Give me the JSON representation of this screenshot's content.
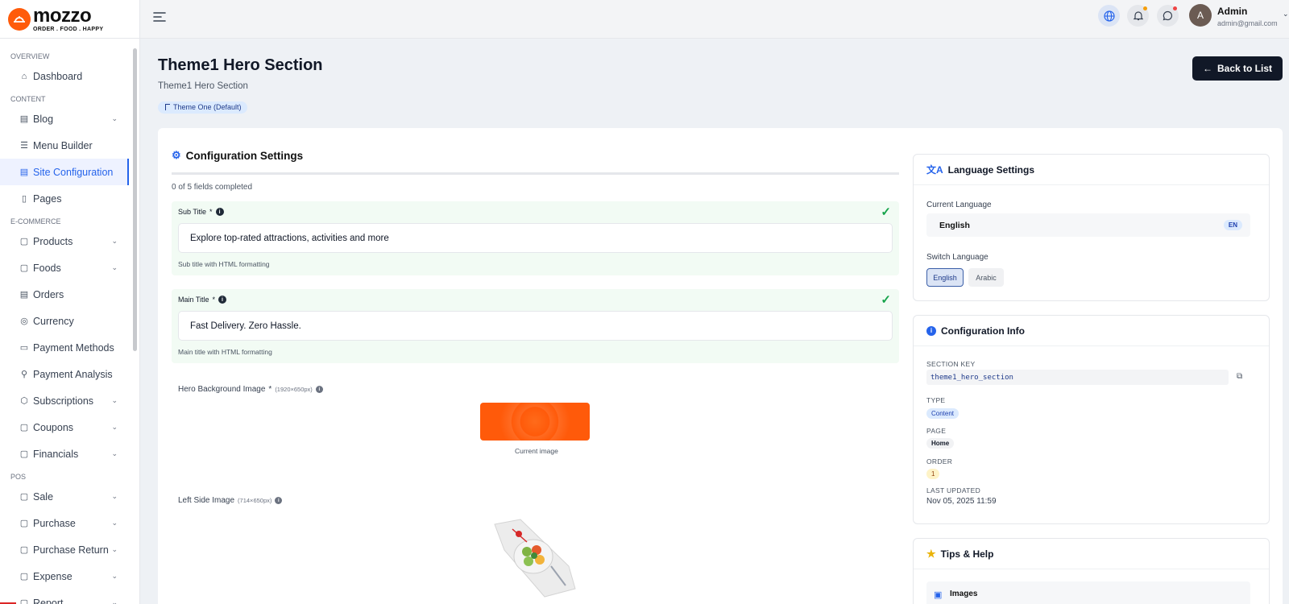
{
  "brand": {
    "name": "mozzo",
    "tagline": "ORDER . FOOD . HAPPY"
  },
  "sidebar": {
    "sections": [
      {
        "title": "OVERVIEW",
        "items": [
          {
            "label": "Dashboard",
            "icon": "home-icon",
            "chevron": false
          }
        ]
      },
      {
        "title": "CONTENT",
        "items": [
          {
            "label": "Blog",
            "icon": "newspaper-icon",
            "chevron": true
          },
          {
            "label": "Menu Builder",
            "icon": "menu-icon",
            "chevron": false
          },
          {
            "label": "Site Configuration",
            "icon": "document-icon",
            "chevron": false,
            "active": true
          },
          {
            "label": "Pages",
            "icon": "file-icon",
            "chevron": false
          }
        ]
      },
      {
        "title": "E-COMMERCE",
        "items": [
          {
            "label": "Products",
            "icon": "box-icon",
            "chevron": true
          },
          {
            "label": "Foods",
            "icon": "box-icon",
            "chevron": true
          },
          {
            "label": "Orders",
            "icon": "orders-icon",
            "chevron": false
          },
          {
            "label": "Currency",
            "icon": "currency-icon",
            "chevron": false
          },
          {
            "label": "Payment Methods",
            "icon": "card-icon",
            "chevron": false
          },
          {
            "label": "Payment Analysis",
            "icon": "analysis-icon",
            "chevron": false
          },
          {
            "label": "Subscriptions",
            "icon": "package-icon",
            "chevron": true
          },
          {
            "label": "Coupons",
            "icon": "coupon-icon",
            "chevron": true
          },
          {
            "label": "Financials",
            "icon": "box-icon",
            "chevron": true
          }
        ]
      },
      {
        "title": "POS",
        "items": [
          {
            "label": "Sale",
            "icon": "box-icon",
            "chevron": true
          },
          {
            "label": "Purchase",
            "icon": "box-icon",
            "chevron": true
          },
          {
            "label": "Purchase Return",
            "icon": "box-icon",
            "chevron": true
          },
          {
            "label": "Expense",
            "icon": "box-icon",
            "chevron": true
          },
          {
            "label": "Report",
            "icon": "box-icon",
            "chevron": true
          }
        ]
      }
    ]
  },
  "topbar": {
    "user_name": "Admin",
    "user_email": "admin@gmail.com"
  },
  "header": {
    "title": "Theme1 Hero Section",
    "subtitle": "Theme1 Hero Section",
    "theme_badge": "Theme One (Default)",
    "back_label": "Back to List"
  },
  "config": {
    "title": "Configuration Settings",
    "progress_text": "0 of 5 fields completed",
    "progress_fraction": 0,
    "fields": [
      {
        "label": "Sub Title",
        "required": "*",
        "value": "Explore top-rated attractions, activities and more",
        "help": "Sub title with HTML formatting"
      },
      {
        "label": "Main Title",
        "required": "*",
        "value": "Fast Delivery. Zero Hassle.",
        "help": "Main title with HTML formatting"
      }
    ],
    "hero_image": {
      "label": "Hero Background Image",
      "required": "*",
      "dims": "(1920×650px)",
      "caption": "Current image"
    },
    "left_image": {
      "label": "Left Side Image",
      "dims": "(714×650px)"
    }
  },
  "language": {
    "title": "Language Settings",
    "current_label": "Current Language",
    "current_value": "English",
    "current_code": "EN",
    "switch_label": "Switch Language",
    "options": [
      "English",
      "Arabic"
    ]
  },
  "config_info": {
    "title": "Configuration Info",
    "section_key_label": "SECTION KEY",
    "section_key": "theme1_hero_section",
    "type_label": "TYPE",
    "type_value": "Content",
    "page_label": "PAGE",
    "page_value": "Home",
    "order_label": "ORDER",
    "order_value": "1",
    "updated_label": "LAST UPDATED",
    "updated_value": "Nov 05, 2025 11:59"
  },
  "tips": {
    "title": "Tips & Help",
    "item_title": "Images"
  },
  "colors": {
    "accent": "#2563eb",
    "brand": "#ff5b0a",
    "success": "#16a34a",
    "dark_button": "#111827"
  }
}
